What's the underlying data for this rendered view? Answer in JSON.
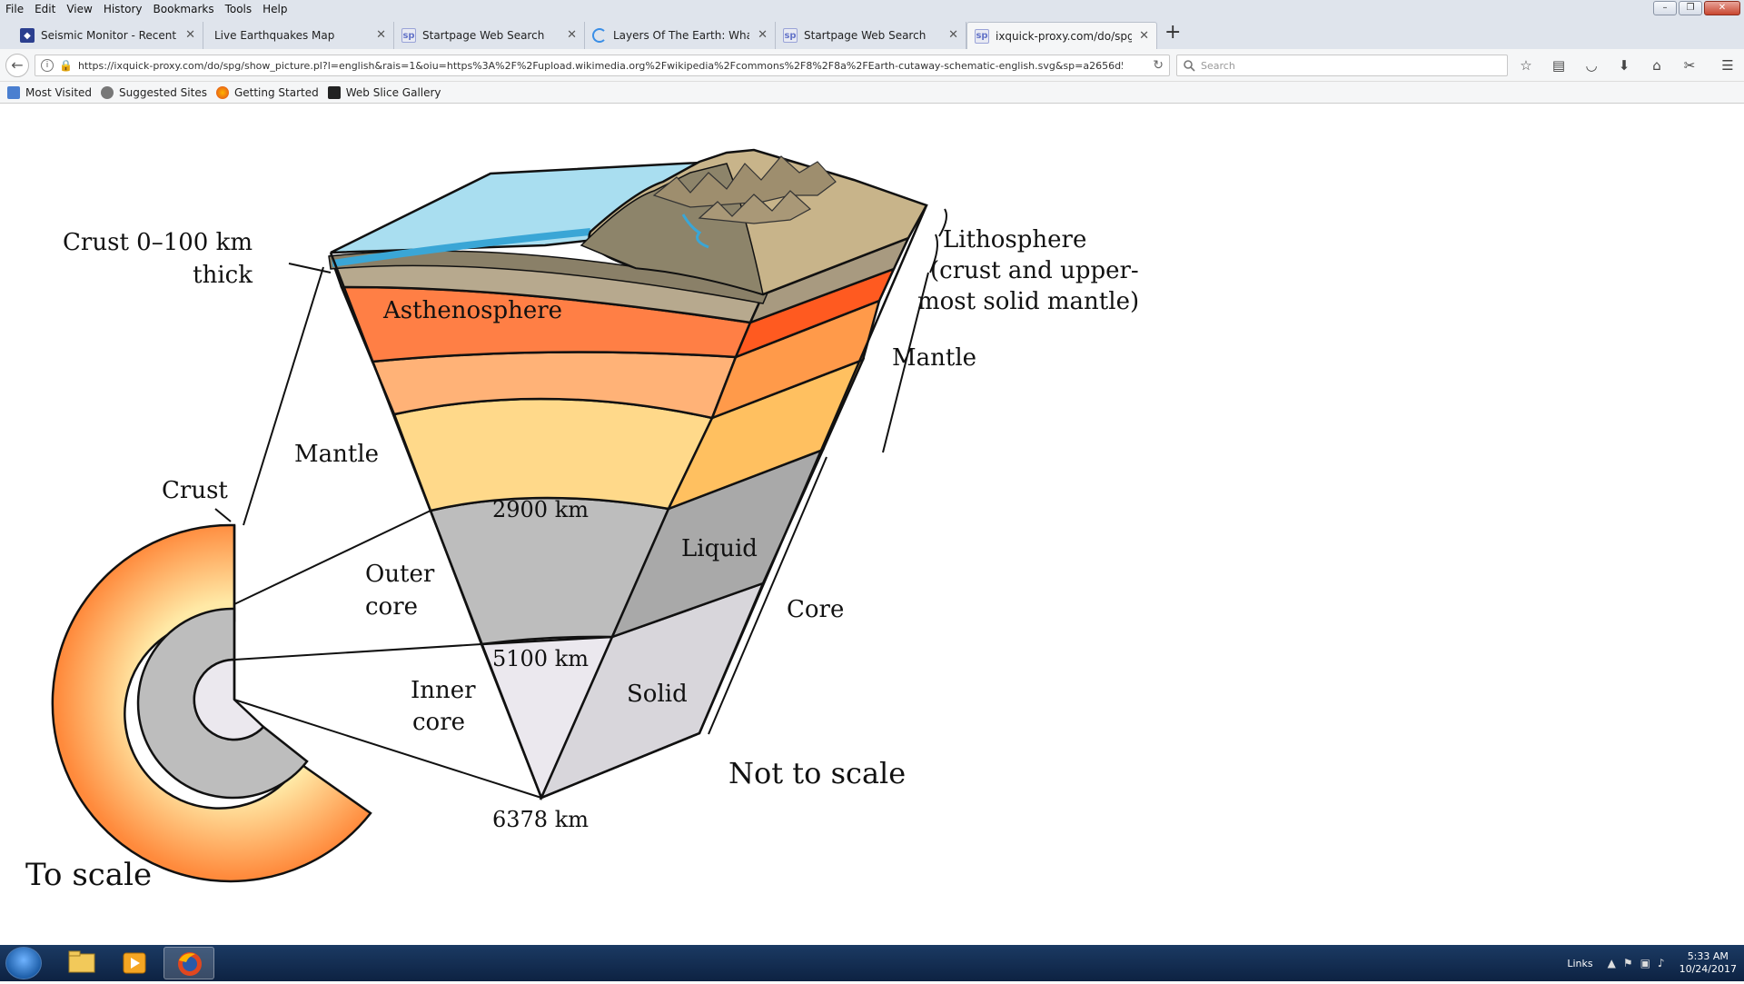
{
  "menu": [
    "File",
    "Edit",
    "View",
    "History",
    "Bookmarks",
    "Tools",
    "Help"
  ],
  "tabs": [
    {
      "label": "Seismic Monitor - Recent ear",
      "icon": "seismic-icon"
    },
    {
      "label": "Live Earthquakes Map",
      "icon": "none"
    },
    {
      "label": "Startpage Web Search",
      "icon": "sp-icon"
    },
    {
      "label": "Layers Of The Earth: What Li",
      "icon": "loading-icon"
    },
    {
      "label": "Startpage Web Search",
      "icon": "sp-icon"
    },
    {
      "label": "ixquick-proxy.com/do/spg/s",
      "icon": "sp-icon"
    }
  ],
  "url": "https://ixquick-proxy.com/do/spg/show_picture.pl?l=english&rais=1&oiu=https%3A%2F%2Fupload.wikimedia.org%2Fwikipedia%2Fcommons%2F8%2F8a%2FEarth-cutaway-schematic-english.svg&sp=a2656d582a7b",
  "search_placeholder": "Search",
  "bookmarks": [
    "Most Visited",
    "Suggested Sites",
    "Getting Started",
    "Web Slice Gallery"
  ],
  "diagram": {
    "crust_thickness_line1": "Crust 0–100 km",
    "crust_thickness_line2": "thick",
    "lithosphere_line1": "Lithosphere",
    "lithosphere_line2": "(crust and upper-",
    "lithosphere_line3": "most solid mantle)",
    "asthenosphere": "Asthenosphere",
    "mantle_left": "Mantle",
    "mantle_right": "Mantle",
    "crust_small": "Crust",
    "depth_2900": "2900 km",
    "liquid": "Liquid",
    "outer_core_line1": "Outer",
    "outer_core_line2": "core",
    "core": "Core",
    "depth_5100": "5100 km",
    "inner_core_line1": "Inner",
    "inner_core_line2": "core",
    "solid": "Solid",
    "not_to_scale": "Not to scale",
    "depth_6378": "6378 km",
    "to_scale": "To scale"
  },
  "tray": {
    "links": "Links",
    "time": "5:33 AM",
    "date": "10/24/2017"
  },
  "colors": {
    "ocean": "#a9def0",
    "ocean_edge": "#3aa6d6",
    "asthenosphere": "#ff7f45",
    "mantle_mid": "#ffb277",
    "mantle_low": "#ffd98a",
    "outer_core": "#bdbdbd",
    "inner_core": "#e8e6ea"
  }
}
